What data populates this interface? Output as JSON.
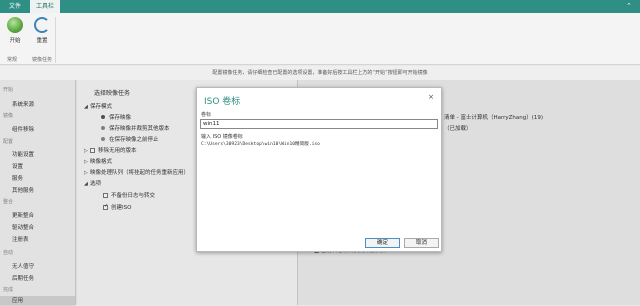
{
  "tabs": {
    "file": "文件",
    "tools": "工具栏"
  },
  "ribbon": {
    "start_label": "开始",
    "reset_label": "重置",
    "group1": "常规",
    "group2": "镜像任务"
  },
  "hint": "配置镜像任务，请仔细检查已配置的选项设置，准备好后按工具栏上方的“开始”按钮即可开始镜像",
  "nav": {
    "cat_start": "开始",
    "system_source": "系统来源",
    "cat_image": "镜像",
    "component_removal": "组件移除",
    "cat_config": "配置",
    "features": "功能设置",
    "settings": "设置",
    "services": "服务",
    "other_services": "其他服务",
    "cat_integrate": "整合",
    "update_integrate": "更新整合",
    "driver_integrate": "驱动整合",
    "registry": "注册表",
    "cat_auto": "自动",
    "unattended": "无人值守",
    "post_setup": "后期任务",
    "cat_finish": "完成",
    "apply": "应用"
  },
  "middle": {
    "heading": "选择映像任务",
    "save_mode": "保存模式",
    "save_image": "保存映像",
    "save_and_rebuild": "保存映像并裁剪其他版本",
    "stop_after_save": "在保存映像之前停止",
    "remove_unused": "移除无用的版本",
    "image_format": "映像格式",
    "image_queue": "映像处理队列（将挂起的任务重新应用）",
    "options": "选项",
    "no_log": "不备份日志与转交",
    "create_iso": "创建ISO"
  },
  "right": {
    "line1": "清单 - 富士计算机（HarryZhang）(19)",
    "line2": "（已加载）",
    "line3": "■ 备份日志和转交的映像文件"
  },
  "dialog": {
    "title": "ISO 卷标",
    "close": "×",
    "volume_label": "卷标",
    "volume_value": "win11",
    "info_line1": "输入 ISO 镜像卷标",
    "info_path": "C:\\Users\\30923\\Desktop\\win10\\Win10精简版.iso",
    "ok": "确定",
    "cancel": "取消"
  },
  "colors": {
    "accent": "#2f8f85",
    "ribbon_bg": "#f4f4f4"
  },
  "icons": {
    "start": "start-icon",
    "reset": "refresh-icon"
  }
}
